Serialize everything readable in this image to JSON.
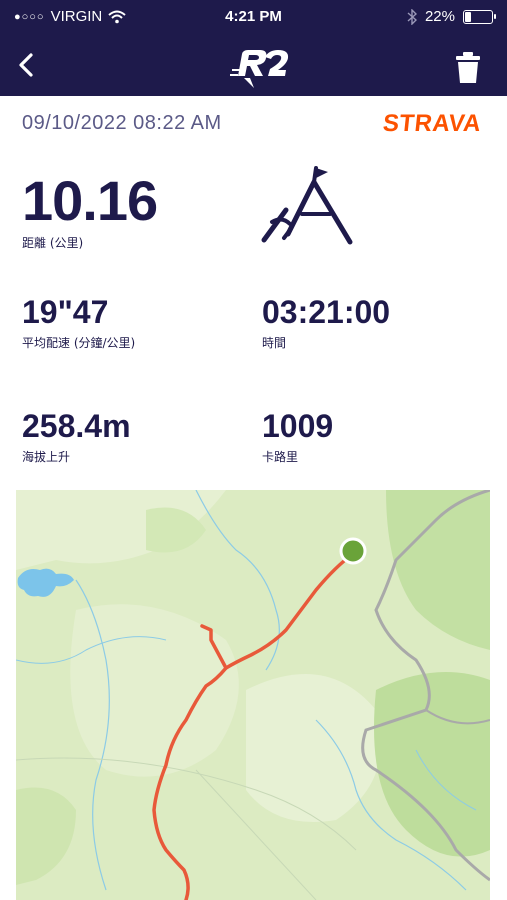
{
  "status_bar": {
    "carrier": "VIRGIN",
    "signal_dots": "●○○○",
    "time": "4:21 PM",
    "battery_percent": "22%"
  },
  "nav": {
    "logo_text": "R2",
    "back_icon": "chevron-left-icon",
    "delete_icon": "trash-icon"
  },
  "activity": {
    "date_time": "09/10/2022 08:22 AM",
    "source": "STRAVA",
    "activity_icon": "mountain-flag-icon",
    "distance": {
      "value": "10.16",
      "label": "距離 (公里)"
    },
    "pace": {
      "value": "19\"47",
      "label": "平均配速 (分鐘/公里)"
    },
    "duration": {
      "value": "03:21:00",
      "label": "時間"
    },
    "elevation": {
      "value": "258.4m",
      "label": "海拔上升"
    },
    "calories": {
      "value": "1009",
      "label": "卡路里"
    }
  },
  "colors": {
    "header_bg": "#1e1a4b",
    "text_primary": "#1e1a4b",
    "strava_orange": "#fc5200",
    "route": "#e8593a",
    "start_marker": "#6aa339"
  }
}
